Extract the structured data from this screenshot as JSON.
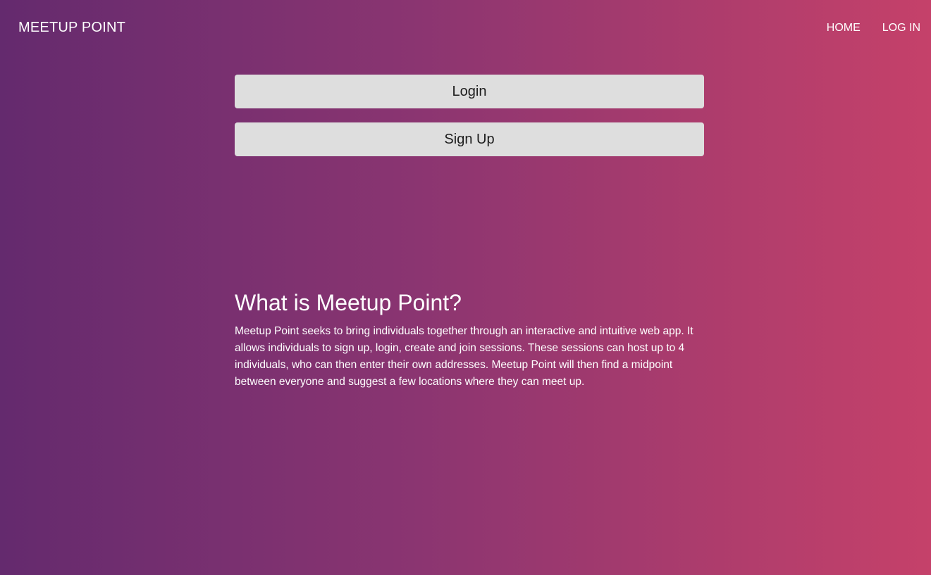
{
  "navbar": {
    "brand": "MEETUP POINT",
    "links": [
      {
        "label": "HOME"
      },
      {
        "label": "LOG IN"
      }
    ]
  },
  "actions": {
    "login_label": "Login",
    "signup_label": "Sign Up"
  },
  "about": {
    "heading": "What is Meetup Point?",
    "description": "Meetup Point seeks to bring individuals together through an interactive and intuitive web app. It allows individuals to sign up, login, create and join sessions. These sessions can host up to 4 individuals, who can then enter their own addresses. Meetup Point will then find a midpoint between everyone and suggest a few locations where they can meet up."
  },
  "theme": {
    "gradient_start": "#642a6e",
    "gradient_end": "#c5416a",
    "button_background": "#dedede",
    "button_text": "#1c1c1c"
  }
}
